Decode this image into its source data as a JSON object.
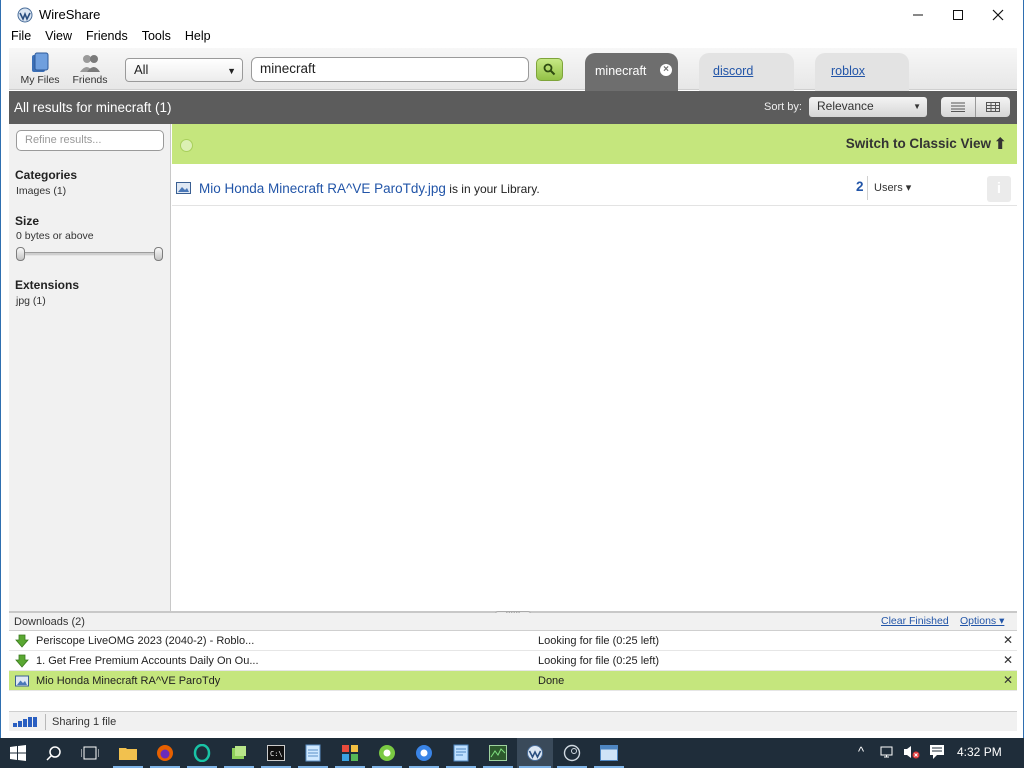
{
  "window": {
    "title": "WireShare"
  },
  "menu": [
    "File",
    "View",
    "Friends",
    "Tools",
    "Help"
  ],
  "toolbar": {
    "my_files_label": "My Files",
    "friends_label": "Friends",
    "filter_value": "All",
    "search_value": "minecraft"
  },
  "tabs": [
    {
      "label": "minecraft",
      "active": true
    },
    {
      "label": "discord",
      "active": false
    },
    {
      "label": "roblox",
      "active": false
    }
  ],
  "results_bar": {
    "title": "All results for minecraft (1)",
    "sort_label": "Sort by:",
    "sort_value": "Relevance"
  },
  "sidebar": {
    "refine_placeholder": "Refine results...",
    "categories_heading": "Categories",
    "categories_value": "Images (1)",
    "size_heading": "Size",
    "size_value": "0 bytes or above",
    "extensions_heading": "Extensions",
    "extensions_value": "jpg (1)"
  },
  "main": {
    "classic_view_label": "Switch to Classic View",
    "result": {
      "name": "Mio Honda Minecraft RA^VE ParoTdy.jpg",
      "suffix": " is in your Library.",
      "count": "2",
      "users_label": "Users ▾"
    }
  },
  "downloads": {
    "title": "Downloads (2)",
    "clear_label": "Clear Finished",
    "options_label": "Options ▾",
    "rows": [
      {
        "name": "Periscope LiveOMG 2023 (2040-2) - Roblo...",
        "status": "Looking for file (0:25 left)",
        "icon": "download-arrow-icon"
      },
      {
        "name": "1. Get Free Premium Accounts Daily On Ou...",
        "status": "Looking for file (0:25 left)",
        "icon": "download-arrow-icon"
      },
      {
        "name": "Mio Honda Minecraft RA^VE ParoTdy",
        "status": "Done",
        "icon": "image-file-icon"
      }
    ]
  },
  "statusbar": {
    "text": "Sharing 1 file"
  },
  "taskbar": {
    "clock": "4:32 PM"
  },
  "colors": {
    "accent_green": "#c5e67d",
    "dark_bar": "#5c5c5c",
    "link_blue": "#2255a8"
  }
}
